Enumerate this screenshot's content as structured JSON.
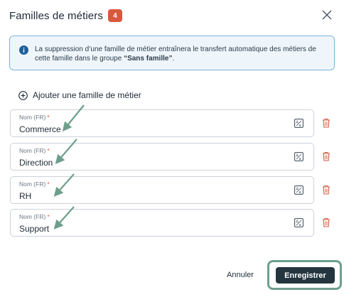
{
  "dialog": {
    "title": "Familles de métiers",
    "count": "4",
    "close_icon": "close-icon"
  },
  "info": {
    "icon": "info-icon",
    "text_before": "La suppression d’une famille de métier entraînera le transfert automatique des métiers de cette famille dans le groupe ",
    "text_bold": "“Sans famille”",
    "text_after": "."
  },
  "add_family": {
    "icon": "plus-circle-icon",
    "label": "Ajouter une famille de métier"
  },
  "families": [
    {
      "label": "Nom (FR)",
      "required": "*",
      "value": "Commerce"
    },
    {
      "label": "Nom (FR)",
      "required": "*",
      "value": "Direction"
    },
    {
      "label": "Nom (FR)",
      "required": "*",
      "value": "RH"
    },
    {
      "label": "Nom (FR)",
      "required": "*",
      "value": "Support"
    }
  ],
  "footer": {
    "cancel_label": "Annuler",
    "save_label": "Enregistrer"
  },
  "colors": {
    "badge": "#d9583f",
    "info_border": "#7fb3d7",
    "info_bg": "#eef6fb",
    "info_icon": "#1f5f9a",
    "trash": "#d9583f",
    "save_bg": "#24353f",
    "annotation": "#6e9f8c"
  }
}
